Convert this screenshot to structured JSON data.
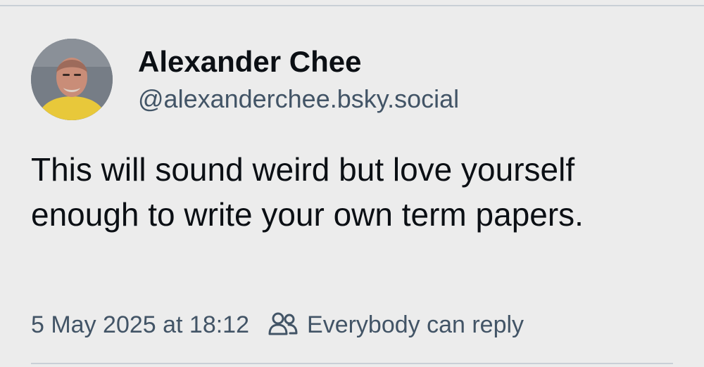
{
  "post": {
    "author": {
      "display_name": "Alexander Chee",
      "handle": "@alexanderchee.bsky.social",
      "avatar_icon": "user-avatar-photo"
    },
    "text": "This will sound weird but love yourself enough to write your own term papers.",
    "timestamp": "5 May 2025 at 18:12",
    "reply_setting": {
      "icon": "people-icon",
      "label": "Everybody can reply"
    }
  },
  "colors": {
    "background": "#ececec",
    "primary_text": "#0b0f14",
    "secondary_text": "#425466",
    "divider": "#c9cfd6"
  }
}
